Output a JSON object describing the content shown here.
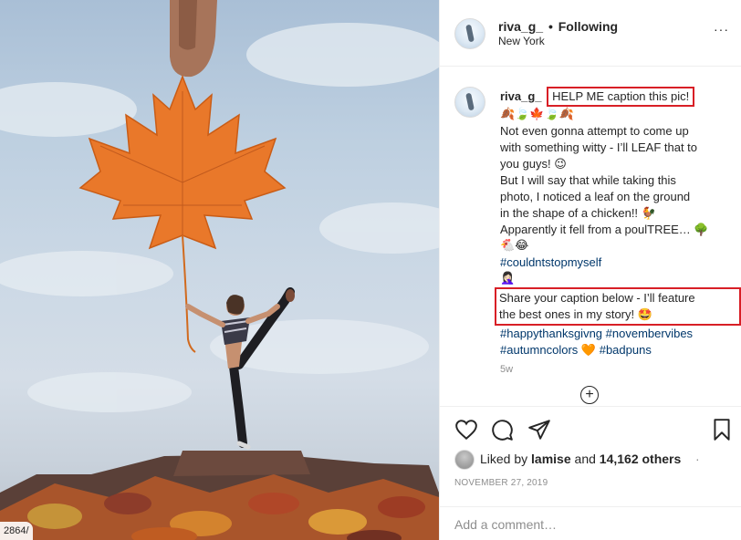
{
  "photo": {
    "badge": "2864/"
  },
  "header": {
    "username": "riva_g_",
    "separator": "•",
    "follow_status": "Following",
    "location": "New York",
    "more": "···"
  },
  "caption": {
    "username": "riva_g_",
    "title": "HELP ME caption this pic!",
    "emoji_row": "🍂🍃🍁🍃🍂",
    "lines": [
      "Not even gonna attempt to come up",
      "with something witty - I’ll LEAF that to",
      "you guys! 😉",
      "But I will say that while taking this",
      "photo, I noticed a leaf on the ground",
      "in the shape of a chicken!! 🐓",
      "Apparently it fell from a poulTREE… 🌳",
      "🐔😂"
    ],
    "hashtag_1": "#couldntstopmyself",
    "emoji_person": "🤦🏻‍♀️",
    "boxed_lines": [
      "Share your caption below - I’ll feature",
      "the best ones in my story! 🤩"
    ],
    "hashtags_2": [
      "#happythanksgivng",
      "#novembervibes"
    ],
    "hashtags_3a": "#autumncolors",
    "heart_emoji": "🧡",
    "hashtags_3b": "#badpuns",
    "time_ago": "5w",
    "load_more": "+"
  },
  "actions": {
    "like_icon": "heart-icon",
    "comment_icon": "comment-icon",
    "share_icon": "share-icon",
    "save_icon": "bookmark-icon"
  },
  "likes": {
    "prefix": "Liked by",
    "user": "lamise",
    "and": "and",
    "count": "14,162 others",
    "more": "·"
  },
  "date": "NOVEMBER 27, 2019",
  "comment": {
    "placeholder": "Add a comment…"
  },
  "colors": {
    "highlight_box": "#d81f26",
    "hashtag": "#00376b",
    "leaf": "#e9782a"
  }
}
